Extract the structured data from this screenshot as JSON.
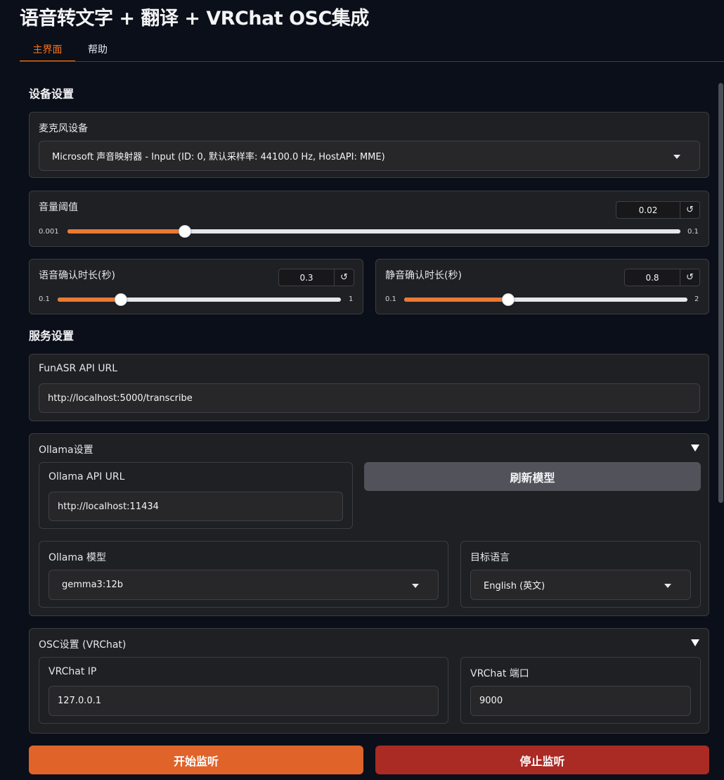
{
  "app": {
    "title": "语音转文字 + 翻译 + VRChat OSC集成"
  },
  "tabs": [
    {
      "label": "主界面",
      "active": true
    },
    {
      "label": "帮助",
      "active": false
    }
  ],
  "device_settings": {
    "title": "设备设置",
    "microphone": {
      "label": "麦克风设备",
      "value": "Microsoft 声音映射器 - Input (ID: 0, 默认采样率: 44100.0 Hz, HostAPI: MME)"
    },
    "volume_threshold": {
      "label": "音量阈值",
      "value": "0.02",
      "min": "0.001",
      "max": "0.1",
      "value_num": 0.02,
      "min_num": 0.001,
      "max_num": 0.1
    },
    "speech_confirm": {
      "label": "语音确认时长(秒)",
      "value": "0.3",
      "min": "0.1",
      "max": "1",
      "value_num": 0.3,
      "min_num": 0.1,
      "max_num": 1
    },
    "silence_confirm": {
      "label": "静音确认时长(秒)",
      "value": "0.8",
      "min": "0.1",
      "max": "2",
      "value_num": 0.8,
      "min_num": 0.1,
      "max_num": 2
    }
  },
  "service_settings": {
    "title": "服务设置",
    "funasr": {
      "label": "FunASR API URL",
      "value": "http://localhost:5000/transcribe"
    },
    "ollama": {
      "title": "Ollama设置",
      "api_url": {
        "label": "Ollama API URL",
        "value": "http://localhost:11434"
      },
      "refresh_button": "刷新模型",
      "model": {
        "label": "Ollama 模型",
        "value": "gemma3:12b"
      },
      "target_language": {
        "label": "目标语言",
        "value": "English (英文)"
      }
    },
    "osc": {
      "title": "OSC设置 (VRChat)",
      "ip": {
        "label": "VRChat IP",
        "value": "127.0.0.1"
      },
      "port": {
        "label": "VRChat 端口",
        "value": "9000"
      }
    }
  },
  "actions": {
    "start": "开始监听",
    "stop": "停止监听"
  },
  "icons": {
    "reset": "reset-icon",
    "dropdown": "chevron-down-icon",
    "accordion": "triangle-down-icon"
  },
  "colors": {
    "accent": "#ea7a32",
    "start_button": "#e0632a",
    "stop_button": "#aa2a24"
  }
}
